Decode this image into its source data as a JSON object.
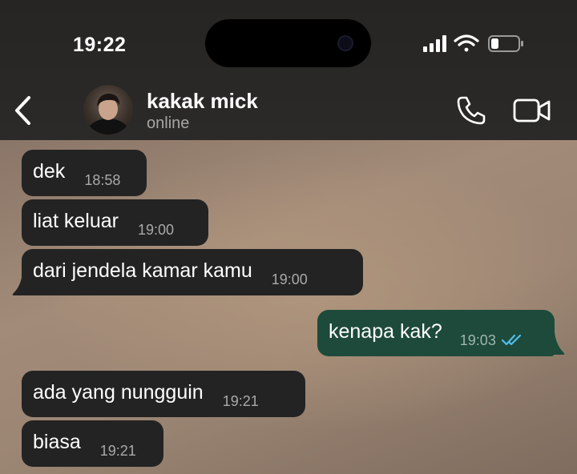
{
  "status_bar": {
    "time": "19:22"
  },
  "header": {
    "contact_name": "kakak mick",
    "contact_status": "online"
  },
  "messages": [
    {
      "direction": "incoming",
      "text": "dek",
      "time": "18:58"
    },
    {
      "direction": "incoming",
      "text": "liat keluar",
      "time": "19:00"
    },
    {
      "direction": "incoming",
      "text": "dari jendela kamar kamu",
      "time": "19:00"
    },
    {
      "direction": "outgoing",
      "text": "kenapa kak?",
      "time": "19:03",
      "read": true
    },
    {
      "direction": "incoming",
      "text": "ada yang nungguin",
      "time": "19:21"
    },
    {
      "direction": "incoming",
      "text": "biasa",
      "time": "19:21"
    }
  ],
  "icons": [
    "back-icon",
    "phone-icon",
    "video-camera-icon",
    "signal-icon",
    "wifi-icon",
    "battery-icon",
    "double-check-icon"
  ],
  "colors": {
    "incoming_bubble": "#232323",
    "outgoing_bubble": "#1d4a3b",
    "read_ticks": "#53bdeb"
  }
}
